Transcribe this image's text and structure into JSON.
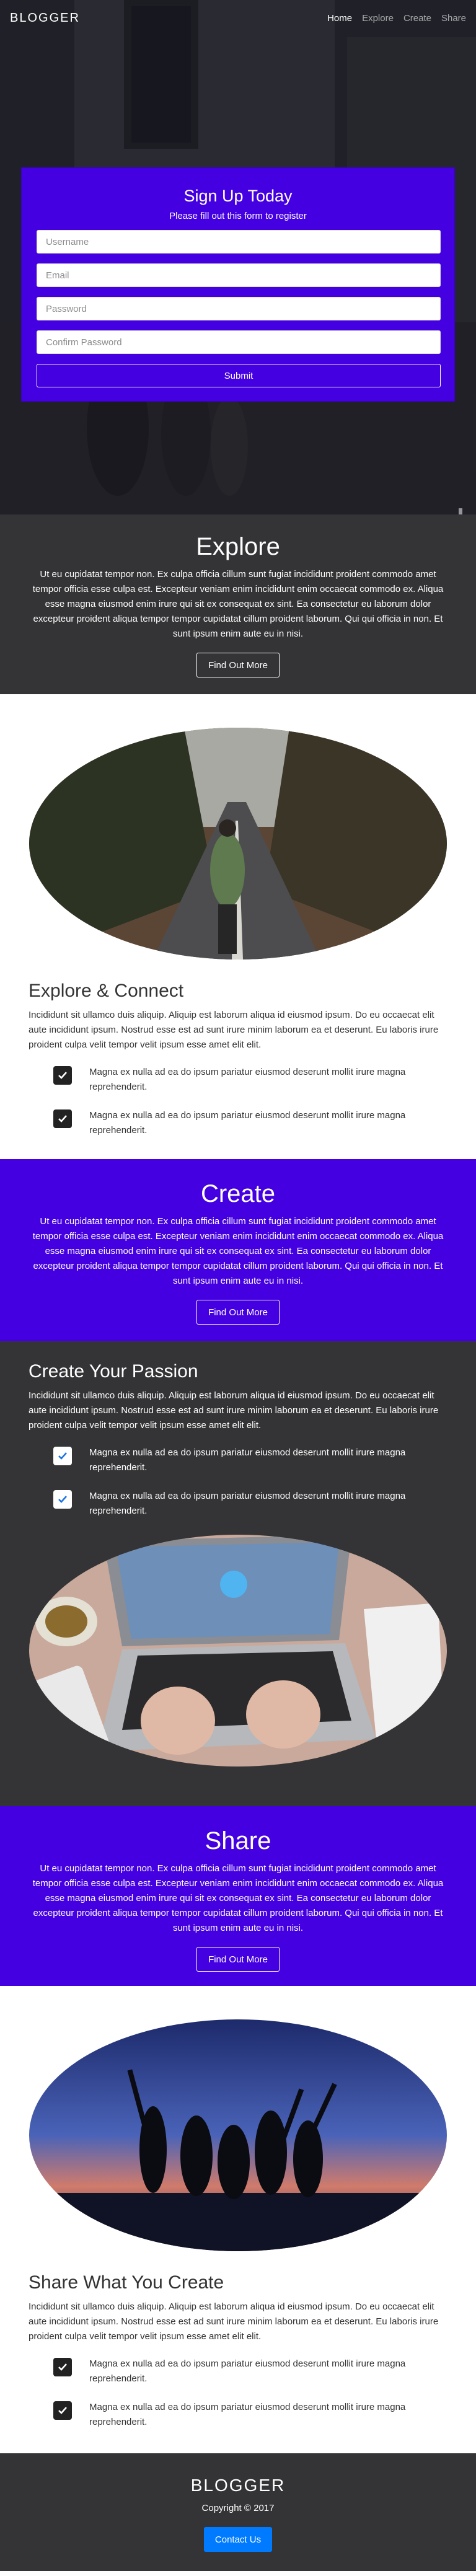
{
  "nav": {
    "brand": "BLOGGER",
    "links": [
      {
        "label": "Home",
        "active": true
      },
      {
        "label": "Explore",
        "active": false
      },
      {
        "label": "Create",
        "active": false
      },
      {
        "label": "Share",
        "active": false
      }
    ]
  },
  "signup": {
    "title": "Sign Up Today",
    "subtitle": "Please fill out this form to register",
    "fields": [
      {
        "placeholder": "Username",
        "value": ""
      },
      {
        "placeholder": "Email",
        "value": ""
      },
      {
        "placeholder": "Password",
        "value": ""
      },
      {
        "placeholder": "Confirm Password",
        "value": ""
      }
    ],
    "submit_label": "Submit"
  },
  "explore_band": {
    "title": "Explore",
    "text": "Ut eu cupidatat tempor non. Ex culpa officia cillum sunt fugiat incididunt proident commodo amet tempor officia esse culpa est. Excepteur veniam enim incididunt enim occaecat commodo ex. Aliqua esse magna eiusmod enim irure qui sit ex consequat ex sint. Ea consectetur eu laborum dolor excepteur proident aliqua tempor tempor cupidatat cillum proident laborum. Qui qui officia in non. Et sunt ipsum enim aute eu in nisi.",
    "button": "Find Out More"
  },
  "explore_feature": {
    "heading": "Explore & Connect",
    "text": "Incididunt sit ullamco duis aliquip. Aliquip est laborum aliqua id eiusmod ipsum. Do eu occaecat elit aute incididunt ipsum. Nostrud esse est ad sunt irure minim laborum ea et deserunt. Eu laboris irure proident culpa velit tempor velit ipsum esse amet elit elit.",
    "items": [
      "Magna ex nulla ad ea do ipsum pariatur eiusmod deserunt mollit irure magna reprehenderit.",
      "Magna ex nulla ad ea do ipsum pariatur eiusmod deserunt mollit irure magna reprehenderit."
    ]
  },
  "create_band": {
    "title": "Create",
    "text": "Ut eu cupidatat tempor non. Ex culpa officia cillum sunt fugiat incididunt proident commodo amet tempor officia esse culpa est. Excepteur veniam enim incididunt enim occaecat commodo ex. Aliqua esse magna eiusmod enim irure qui sit ex consequat ex sint. Ea consectetur eu laborum dolor excepteur proident aliqua tempor tempor cupidatat cillum proident laborum. Qui qui officia in non. Et sunt ipsum enim aute eu in nisi.",
    "button": "Find Out More"
  },
  "create_feature": {
    "heading": "Create Your Passion",
    "text": "Incididunt sit ullamco duis aliquip. Aliquip est laborum aliqua id eiusmod ipsum. Do eu occaecat elit aute incididunt ipsum. Nostrud esse est ad sunt irure minim laborum ea et deserunt. Eu laboris irure proident culpa velit tempor velit ipsum esse amet elit elit.",
    "items": [
      "Magna ex nulla ad ea do ipsum pariatur eiusmod deserunt mollit irure magna reprehenderit.",
      "Magna ex nulla ad ea do ipsum pariatur eiusmod deserunt mollit irure magna reprehenderit."
    ]
  },
  "share_band": {
    "title": "Share",
    "text": "Ut eu cupidatat tempor non. Ex culpa officia cillum sunt fugiat incididunt proident commodo amet tempor officia esse culpa est. Excepteur veniam enim incididunt enim occaecat commodo ex. Aliqua esse magna eiusmod enim irure qui sit ex consequat ex sint. Ea consectetur eu laborum dolor excepteur proident aliqua tempor tempor cupidatat cillum proident laborum. Qui qui officia in non. Et sunt ipsum enim aute eu in nisi.",
    "button": "Find Out More"
  },
  "share_feature": {
    "heading": "Share What You Create",
    "text": "Incididunt sit ullamco duis aliquip. Aliquip est laborum aliqua id eiusmod ipsum. Do eu occaecat elit aute incididunt ipsum. Nostrud esse est ad sunt irure minim laborum ea et deserunt. Eu laboris irure proident culpa velit tempor velit ipsum esse amet elit elit.",
    "items": [
      "Magna ex nulla ad ea do ipsum pariatur eiusmod deserunt mollit irure magna reprehenderit.",
      "Magna ex nulla ad ea do ipsum pariatur eiusmod deserunt mollit irure magna reprehenderit."
    ]
  },
  "footer": {
    "brand": "BLOGGER",
    "copyright": "Copyright © 2017",
    "button": "Contact Us"
  },
  "colors": {
    "purple": "#4400e0",
    "dark": "#343436",
    "primary": "#007bff"
  }
}
